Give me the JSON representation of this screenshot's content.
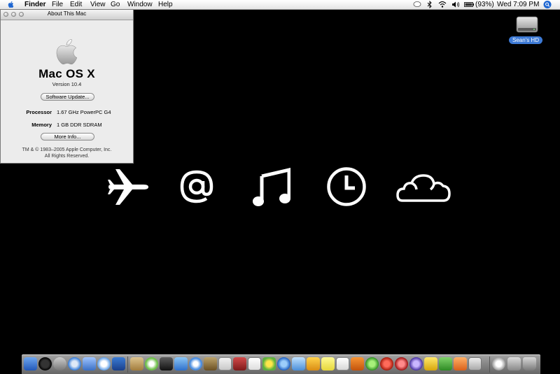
{
  "menubar": {
    "app": "Finder",
    "menus": [
      "File",
      "Edit",
      "View",
      "Go",
      "Window",
      "Help"
    ],
    "battery": "(93%)",
    "clock": "Wed 7:09 PM",
    "status_icons": [
      "speech-bubble-icon",
      "bluetooth-icon",
      "wifi-icon",
      "volume-icon",
      "battery-icon",
      "spotlight-icon"
    ]
  },
  "about_window": {
    "title": "About This Mac",
    "os_name": "Mac OS X",
    "version": "Version 10.4",
    "software_update_button": "Software Update...",
    "processor_label": "Processor",
    "processor_value": "1.67 GHz PowerPC G4",
    "memory_label": "Memory",
    "memory_value": "1 GB DDR SDRAM",
    "more_info_button": "More Info...",
    "copyright_line1": "TM & © 1983–2005 Apple Computer, Inc.",
    "copyright_line2": "All Rights Reserved."
  },
  "desktop": {
    "hd_label": "Sean's HD",
    "glyphs": [
      "airplane-icon",
      "at-sign-icon",
      "music-note-icon",
      "clock-icon",
      "cloud-icon"
    ]
  },
  "dock": {
    "icons": [
      "finder",
      "dashboard",
      "automator",
      "safari",
      "preview",
      "ichat",
      "address-book",
      "sep",
      "notes",
      "itunes",
      "imovie",
      "iphoto",
      "garageband",
      "dictionary",
      "ical",
      "calculator",
      "quicktime",
      "system-prefs",
      "photo-booth",
      "money",
      "stickies",
      "textedit",
      "comic-life",
      "dreamweaver",
      "flash",
      "fireworks",
      "mozilla",
      "fontbook",
      "fetch",
      "pages",
      "image-capture",
      "sep",
      "downloads",
      "documents",
      "trash"
    ]
  },
  "colors": {
    "desktop": "#000000",
    "selection_blue": "#3d7ad6",
    "window_bg": "#ececec"
  }
}
